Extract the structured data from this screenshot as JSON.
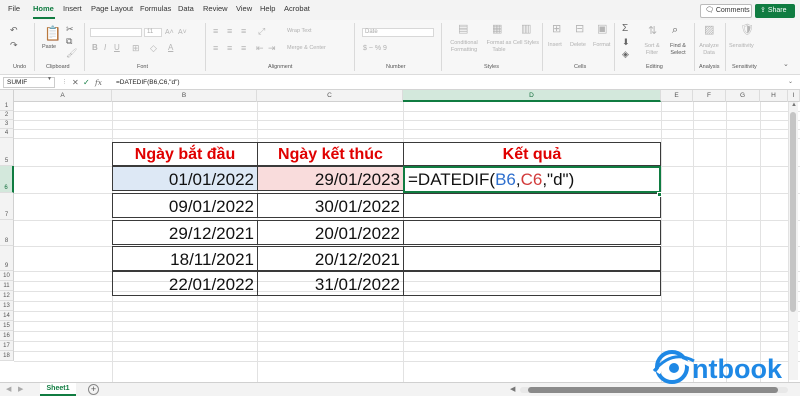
{
  "menu": {
    "items": [
      "File",
      "Home",
      "Insert",
      "Page Layout",
      "Formulas",
      "Data",
      "Review",
      "View",
      "Help",
      "Acrobat"
    ],
    "active": "Home",
    "comments_label": "Comments",
    "share_label": "Share"
  },
  "ribbon": {
    "groups": [
      "Undo",
      "Clipboard",
      "Font",
      "Alignment",
      "Number",
      "Styles",
      "Cells",
      "Editing",
      "Analysis",
      "Sensitivity"
    ],
    "paste_label": "Paste",
    "font_size": "11",
    "wrap_text": "Wrap Text",
    "merge_center": "Merge & Center",
    "number_format": "Date",
    "number_symbols": "$ ~ % 9",
    "conditional_formatting": "Conditional Formatting",
    "format_as_table": "Format as Table",
    "cell_styles": "Cell Styles",
    "insert": "Insert",
    "delete": "Delete",
    "format": "Format",
    "sort_filter": "Sort & Filter",
    "find_select": "Find & Select",
    "analyze_data": "Analyze Data",
    "sensitivity": "Sensitivity"
  },
  "formula_bar": {
    "name_box": "SUMIF",
    "formula": "=DATEDIF(B6,C6,\"d\")"
  },
  "grid": {
    "columns": [
      "A",
      "B",
      "C",
      "D",
      "E",
      "F",
      "G",
      "H",
      "I"
    ],
    "selected_column": "D",
    "rows": [
      "1",
      "2",
      "3",
      "4",
      "5",
      "6",
      "7",
      "8",
      "9",
      "10",
      "11",
      "12",
      "13",
      "14",
      "15",
      "16",
      "17",
      "18"
    ],
    "selected_row": "6"
  },
  "table": {
    "headers": [
      "Ngày bắt đầu",
      "Ngày kết thúc",
      "Kết quả"
    ],
    "rows": [
      {
        "start": "01/01/2022",
        "end": "29/01/2023"
      },
      {
        "start": "09/01/2022",
        "end": "30/01/2022"
      },
      {
        "start": "29/12/2021",
        "end": "20/01/2022"
      },
      {
        "start": "18/11/2021",
        "end": "20/12/2021"
      },
      {
        "start": "22/01/2022",
        "end": "31/01/2022"
      }
    ],
    "editing_formula": {
      "prefix": "=DATEDIF(",
      "ref1": "B6",
      "sep1": ",",
      "ref2": "C6",
      "suffix": ",\"d\")"
    }
  },
  "sheet_tabs": {
    "active": "Sheet1",
    "add_symbol": "+"
  },
  "watermark": {
    "text": "ntbook"
  },
  "colors": {
    "excel_green": "#107c41",
    "header_red": "#e00000",
    "ref_blue": "#2e6fce",
    "ref_red": "#d23b3b"
  }
}
